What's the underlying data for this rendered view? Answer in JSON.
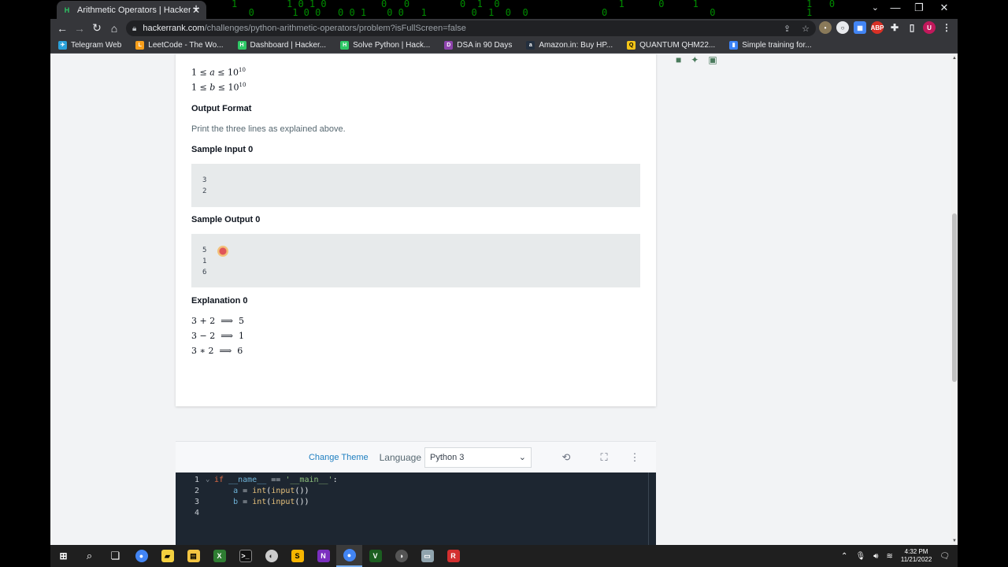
{
  "tab": {
    "title": "Arithmetic Operators | HackerRank",
    "close": "✕",
    "new": "+"
  },
  "window": {
    "minimize": "—",
    "maximize": "❐",
    "close": "✕",
    "tabsearch": "⌄"
  },
  "address": {
    "host": "hackerrank.com",
    "path": "/challenges/python-arithmetic-operators/problem?isFullScreen=false"
  },
  "bookmarks": [
    {
      "label": "Telegram Web",
      "color": "#2aa1da"
    },
    {
      "label": "LeetCode - The Wo...",
      "color": "#f89f1b"
    },
    {
      "label": "Dashboard | Hacker...",
      "color": "#2ec866"
    },
    {
      "label": "Solve Python | Hack...",
      "color": "#2ec866"
    },
    {
      "label": "DSA in 90 Days",
      "color": "#8e44ad"
    },
    {
      "label": "Amazon.in: Buy HP...",
      "color": "#232f3e"
    },
    {
      "label": "QUANTUM QHM22...",
      "color": "#f5c518"
    },
    {
      "label": "Simple training for...",
      "color": "#3b82f6"
    }
  ],
  "problem": {
    "constraint_a": {
      "lhs": "1",
      "var": "a",
      "rhs": "10",
      "exp": "10"
    },
    "constraint_b": {
      "lhs": "1",
      "var": "b",
      "rhs": "10",
      "exp": "10"
    },
    "output_format_heading": "Output Format",
    "output_format_text": "Print the three lines as explained above.",
    "sample_input_heading": "Sample Input 0",
    "sample_input_lines": [
      "3",
      "2"
    ],
    "sample_output_heading": "Sample Output 0",
    "sample_output_lines": [
      "5",
      "1",
      "6"
    ],
    "explanation_heading": "Explanation 0",
    "explanation_lines": [
      {
        "expr": "3 + 2",
        "result": "5"
      },
      {
        "expr": "3 − 2",
        "result": "1"
      },
      {
        "expr": "3 ∗ 2",
        "result": "6"
      }
    ]
  },
  "editor": {
    "change_theme": "Change Theme",
    "language_label": "Language",
    "language_value": "Python 3",
    "line_numbers": [
      "1",
      "2",
      "3",
      "4"
    ],
    "lines": [
      "if __name__ == '__main__':",
      "    a = int(input())",
      "    b = int(input())",
      ""
    ]
  },
  "taskbar": {
    "time": "4:32 PM",
    "date": "11/21/2022"
  }
}
